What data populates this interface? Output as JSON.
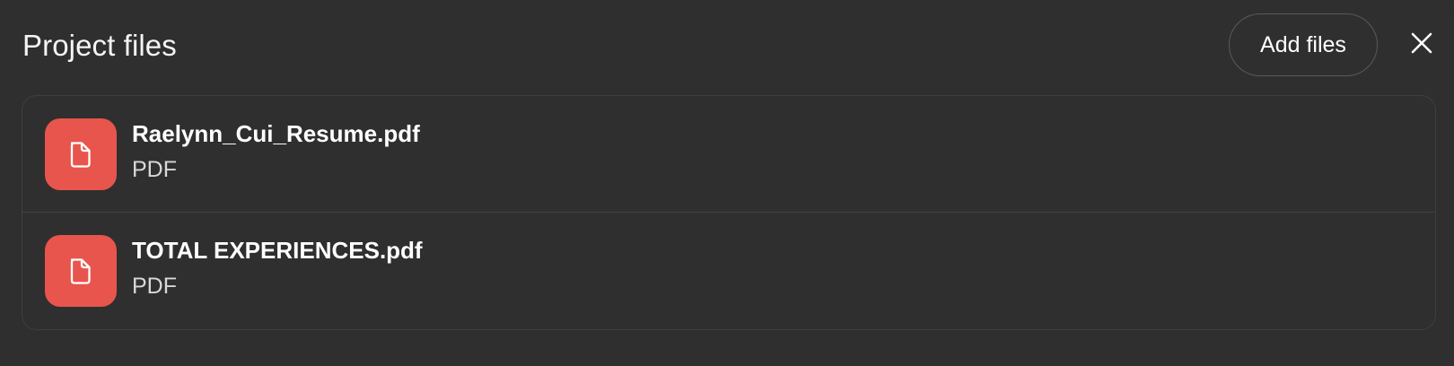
{
  "header": {
    "title": "Project files",
    "add_files_label": "Add files",
    "close_icon": "close-icon"
  },
  "files": [
    {
      "name": "Raelynn_Cui_Resume.pdf",
      "type": "PDF",
      "icon": "document-icon",
      "icon_color": "#e8554d"
    },
    {
      "name": "TOTAL EXPERIENCES.pdf",
      "type": "PDF",
      "icon": "document-icon",
      "icon_color": "#e8554d"
    }
  ],
  "colors": {
    "background": "#2f2f2f",
    "border": "#404040",
    "accent_pdf": "#e8554d",
    "text_primary": "#ffffff",
    "text_secondary": "#d8d8d8"
  }
}
